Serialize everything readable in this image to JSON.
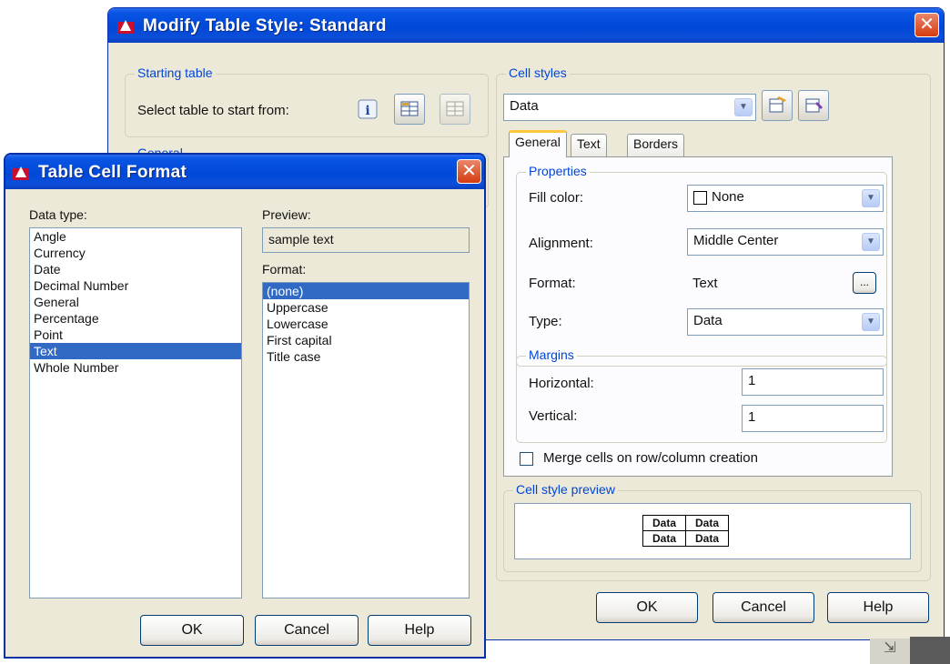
{
  "modify_dialog": {
    "title": "Modify Table Style: Standard",
    "close_glyph": "✕",
    "starting_table": {
      "group_label": "Starting table",
      "select_label": "Select table to start from:"
    },
    "general_group_label": "General",
    "cell_styles": {
      "group_label": "Cell styles",
      "selected": "Data"
    },
    "tabs": [
      "General",
      "Text",
      "Borders"
    ],
    "properties": {
      "group_label": "Properties",
      "fill_color_label": "Fill color:",
      "fill_color_value": "None",
      "alignment_label": "Alignment:",
      "alignment_value": "Middle Center",
      "format_label": "Format:",
      "format_value": "Text",
      "format_button": "...",
      "type_label": "Type:",
      "type_value": "Data"
    },
    "margins": {
      "group_label": "Margins",
      "horizontal_label": "Horizontal:",
      "horizontal_value": "1",
      "vertical_label": "Vertical:",
      "vertical_value": "1"
    },
    "merge_label": "Merge cells on row/column creation",
    "preview": {
      "group_label": "Cell style preview",
      "cells": [
        "Data",
        "Data",
        "Data",
        "Data"
      ]
    },
    "ok_label": "OK",
    "cancel_label": "Cancel",
    "help_label": "Help"
  },
  "cell_format_dialog": {
    "title": "Table Cell Format",
    "close_glyph": "✕",
    "data_type_label": "Data type:",
    "data_types": [
      "Angle",
      "Currency",
      "Date",
      "Decimal Number",
      "General",
      "Percentage",
      "Point",
      "Text",
      "Whole Number"
    ],
    "selected_data_type_index": 7,
    "preview_label": "Preview:",
    "preview_value": "sample text",
    "format_label": "Format:",
    "formats": [
      "(none)",
      "Uppercase",
      "Lowercase",
      "First capital",
      "Title case"
    ],
    "selected_format_index": 0,
    "ok_label": "OK",
    "cancel_label": "Cancel",
    "help_label": "Help"
  },
  "colors": {
    "titlebar": "#0048d8",
    "selection": "#316ac5",
    "dialog_bg": "#ece9d8",
    "group_label": "#0046d5"
  }
}
